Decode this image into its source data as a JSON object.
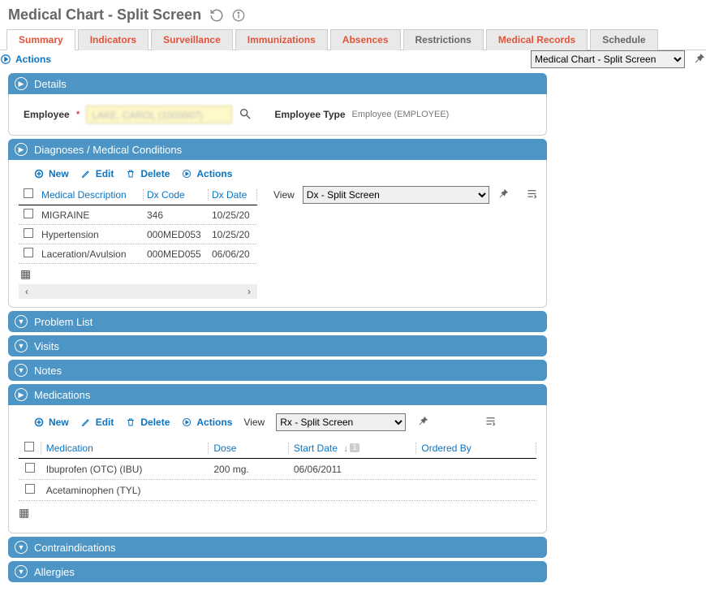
{
  "header": {
    "title": "Medical Chart - Split Screen"
  },
  "tabs": [
    {
      "label": "Summary",
      "active": true,
      "gray": false
    },
    {
      "label": "Indicators",
      "active": false,
      "gray": false
    },
    {
      "label": "Surveillance",
      "active": false,
      "gray": false
    },
    {
      "label": "Immunizations",
      "active": false,
      "gray": false
    },
    {
      "label": "Absences",
      "active": false,
      "gray": false
    },
    {
      "label": "Restrictions",
      "active": false,
      "gray": true
    },
    {
      "label": "Medical Records",
      "active": false,
      "gray": false
    },
    {
      "label": "Schedule",
      "active": false,
      "gray": true
    }
  ],
  "toolbar": {
    "actions_label": "Actions",
    "view_selected": "Medical Chart - Split Screen"
  },
  "details": {
    "title": "Details",
    "employee_label": "Employee",
    "employee_value": "LAKE, CAROL (1000007)",
    "employee_type_label": "Employee Type",
    "employee_type_value": "Employee (EMPLOYEE)"
  },
  "diagnoses": {
    "title": "Diagnoses / Medical Conditions",
    "toolbar": {
      "new": "New",
      "edit": "Edit",
      "delete": "Delete",
      "actions": "Actions"
    },
    "view_label": "View",
    "view_selected": "Dx - Split Screen",
    "columns": {
      "desc": "Medical Description",
      "code": "Dx Code",
      "date": "Dx Date"
    },
    "rows": [
      {
        "desc": "MIGRAINE",
        "code": "346",
        "date": "10/25/20"
      },
      {
        "desc": "Hypertension",
        "code": "000MED053",
        "date": "10/25/20"
      },
      {
        "desc": "Laceration/Avulsion",
        "code": "000MED055",
        "date": "06/06/20"
      }
    ]
  },
  "problem_list": {
    "title": "Problem List"
  },
  "visits": {
    "title": "Visits"
  },
  "notes": {
    "title": "Notes"
  },
  "medications": {
    "title": "Medications",
    "toolbar": {
      "new": "New",
      "edit": "Edit",
      "delete": "Delete",
      "actions": "Actions",
      "view_label": "View",
      "view_selected": "Rx - Split Screen"
    },
    "columns": {
      "med": "Medication",
      "dose": "Dose",
      "start": "Start Date",
      "by": "Ordered By"
    },
    "sort_count": "1",
    "rows": [
      {
        "med": "Ibuprofen (OTC) (IBU)",
        "dose": "200 mg.",
        "start": "06/06/2011",
        "by": ""
      },
      {
        "med": "Acetaminophen (TYL)",
        "dose": "",
        "start": "",
        "by": ""
      }
    ]
  },
  "contraindications": {
    "title": "Contraindications"
  },
  "allergies": {
    "title": "Allergies"
  }
}
